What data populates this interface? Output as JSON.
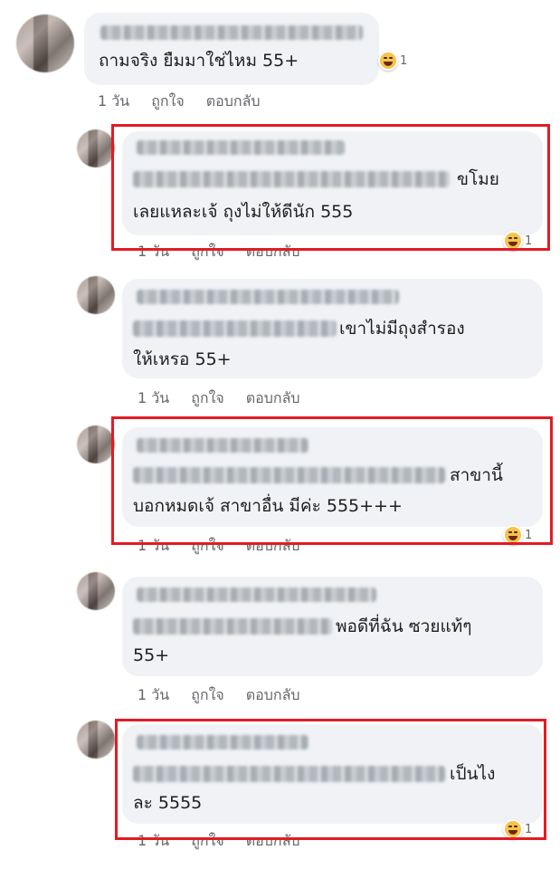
{
  "main_comment": {
    "text": "ถามจริง ยืมมาใช่ไหม 55+",
    "reaction_count": "1",
    "time": "1 วัน",
    "like_label": "ถูกใจ",
    "reply_label": "ตอบกลับ"
  },
  "replies": [
    {
      "line1_tail": "ขโมย",
      "line2": "เลยแหละเจ้ ถุงไม่ให้ดีนัก 555",
      "reaction_count": "1",
      "time": "1 วัน",
      "like_label": "ถูกใจ",
      "reply_label": "ตอบกลับ",
      "highlighted": true
    },
    {
      "line1_tail": "เขาไม่มีถุงสำรอง",
      "line2": "ให้เหรอ 55+",
      "time": "1 วัน",
      "like_label": "ถูกใจ",
      "reply_label": "ตอบกลับ",
      "highlighted": false
    },
    {
      "line1_tail": "สาขานี้",
      "line2": "บอกหมดเจ้ สาขาอื่น มีค่ะ 555+++",
      "reaction_count": "1",
      "time": "1 วัน",
      "like_label": "ถูกใจ",
      "reply_label": "ตอบกลับ",
      "highlighted": true
    },
    {
      "line1_tail": "พอดีที่ฉัน ซวยแท้ๆ",
      "line2": "55+",
      "time": "1 วัน",
      "like_label": "ถูกใจ",
      "reply_label": "ตอบกลับ",
      "highlighted": false
    },
    {
      "line1_tail": "เป็นไง",
      "line2": "ละ 5555",
      "reaction_count": "1",
      "time": "1 วัน",
      "like_label": "ถูกใจ",
      "reply_label": "ตอบกลับ",
      "highlighted": true
    }
  ],
  "colors": {
    "bubble": "#f0f2f5",
    "meta_text": "#65676b",
    "highlight": "#e31b23",
    "reaction": "#f7c34a"
  },
  "icons": {
    "reaction": "haha-reaction-icon",
    "avatar": "blurred-avatar"
  }
}
